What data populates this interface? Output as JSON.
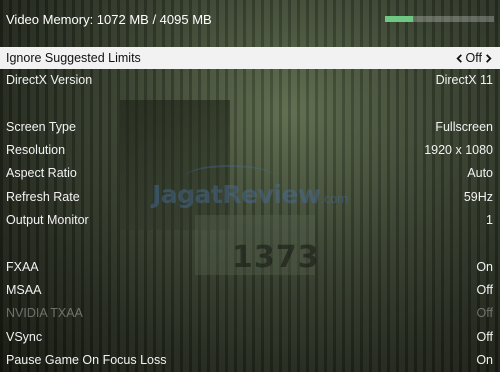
{
  "header": {
    "video_memory_text": "Video Memory: 1072 MB / 4095 MB",
    "video_memory_used_fraction": 0.26,
    "bar_color": "#6fc882"
  },
  "background": {
    "watermark_main": "JagatReview",
    "watermark_suffix": ".com",
    "scene_number": "1373"
  },
  "settings": [
    {
      "label": "Ignore Suggested Limits",
      "value": "Off",
      "state": "selected"
    },
    {
      "label": "DirectX Version",
      "value": "DirectX 11",
      "state": "normal"
    },
    {
      "label": "Screen Type",
      "value": "Fullscreen",
      "state": "normal"
    },
    {
      "label": "Resolution",
      "value": "1920 x 1080",
      "state": "normal"
    },
    {
      "label": "Aspect Ratio",
      "value": "Auto",
      "state": "normal"
    },
    {
      "label": "Refresh Rate",
      "value": "59Hz",
      "state": "normal"
    },
    {
      "label": "Output Monitor",
      "value": "1",
      "state": "normal"
    },
    {
      "label": "FXAA",
      "value": "On",
      "state": "normal"
    },
    {
      "label": "MSAA",
      "value": "Off",
      "state": "normal"
    },
    {
      "label": "NVIDIA TXAA",
      "value": "Off",
      "state": "disabled"
    },
    {
      "label": "VSync",
      "value": "Off",
      "state": "normal"
    },
    {
      "label": "Pause Game On Focus Loss",
      "value": "On",
      "state": "normal"
    }
  ],
  "icons": {
    "left": "chevron-left-icon",
    "right": "chevron-right-icon"
  }
}
